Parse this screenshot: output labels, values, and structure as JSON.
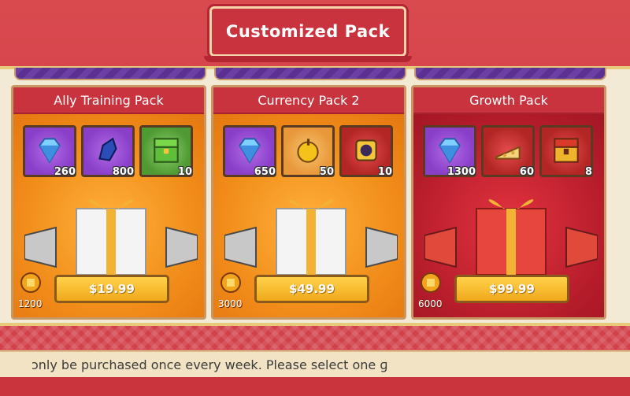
{
  "title": "Customized Pack",
  "packs": [
    {
      "name": "Ally Training Pack",
      "theme": "orange",
      "items": [
        {
          "icon": "gem-icon",
          "count": "260"
        },
        {
          "icon": "crystal-icon",
          "count": "800"
        },
        {
          "icon": "chest-icon",
          "count": "10"
        }
      ],
      "price": "$19.99",
      "token_amount": "1200"
    },
    {
      "name": "Currency Pack 2",
      "theme": "orange",
      "items": [
        {
          "icon": "gem-icon",
          "count": "650"
        },
        {
          "icon": "apple-icon",
          "count": "50"
        },
        {
          "icon": "hero-card-icon",
          "count": "10"
        }
      ],
      "price": "$49.99",
      "token_amount": "3000"
    },
    {
      "name": "Growth Pack",
      "theme": "red",
      "items": [
        {
          "icon": "gem-icon",
          "count": "1300"
        },
        {
          "icon": "cheese-icon",
          "count": "60"
        },
        {
          "icon": "treasure-chest-icon",
          "count": "8"
        }
      ],
      "price": "$99.99",
      "token_amount": "6000"
    }
  ],
  "notice": "ɔnly be purchased once every week. Please select one ɡ"
}
